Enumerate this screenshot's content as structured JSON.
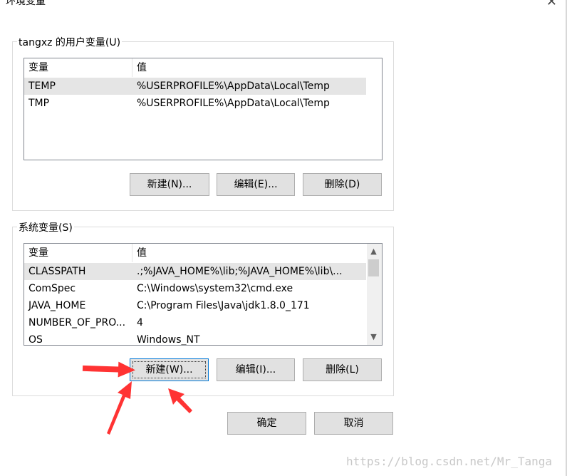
{
  "window": {
    "title": "环境变量"
  },
  "user_vars": {
    "group_label": "tangxz 的用户变量(U)",
    "columns": [
      "变量",
      "值"
    ],
    "rows": [
      {
        "name": "TEMP",
        "value": "%USERPROFILE%\\AppData\\Local\\Temp"
      },
      {
        "name": "TMP",
        "value": "%USERPROFILE%\\AppData\\Local\\Temp"
      }
    ],
    "buttons": {
      "new": "新建(N)...",
      "edit": "编辑(E)...",
      "delete": "删除(D)"
    }
  },
  "system_vars": {
    "group_label": "系统变量(S)",
    "columns": [
      "变量",
      "值"
    ],
    "rows": [
      {
        "name": "CLASSPATH",
        "value": ".;%JAVA_HOME%\\lib;%JAVA_HOME%\\lib\\..."
      },
      {
        "name": "ComSpec",
        "value": "C:\\Windows\\system32\\cmd.exe"
      },
      {
        "name": "JAVA_HOME",
        "value": "C:\\Program Files\\Java\\jdk1.8.0_171"
      },
      {
        "name": "NUMBER_OF_PRO...",
        "value": "4"
      },
      {
        "name": "OS",
        "value": "Windows_NT"
      }
    ],
    "buttons": {
      "new": "新建(W)...",
      "edit": "编辑(I)...",
      "delete": "删除(L)"
    }
  },
  "dialog_buttons": {
    "ok": "确定",
    "cancel": "取消"
  },
  "watermark": "https://blog.csdn.net/Mr_Tanga",
  "colors": {
    "annotation_arrow": "#ff3333",
    "focus_border": "#0078d7",
    "selected_row": "#e5e5e5"
  }
}
